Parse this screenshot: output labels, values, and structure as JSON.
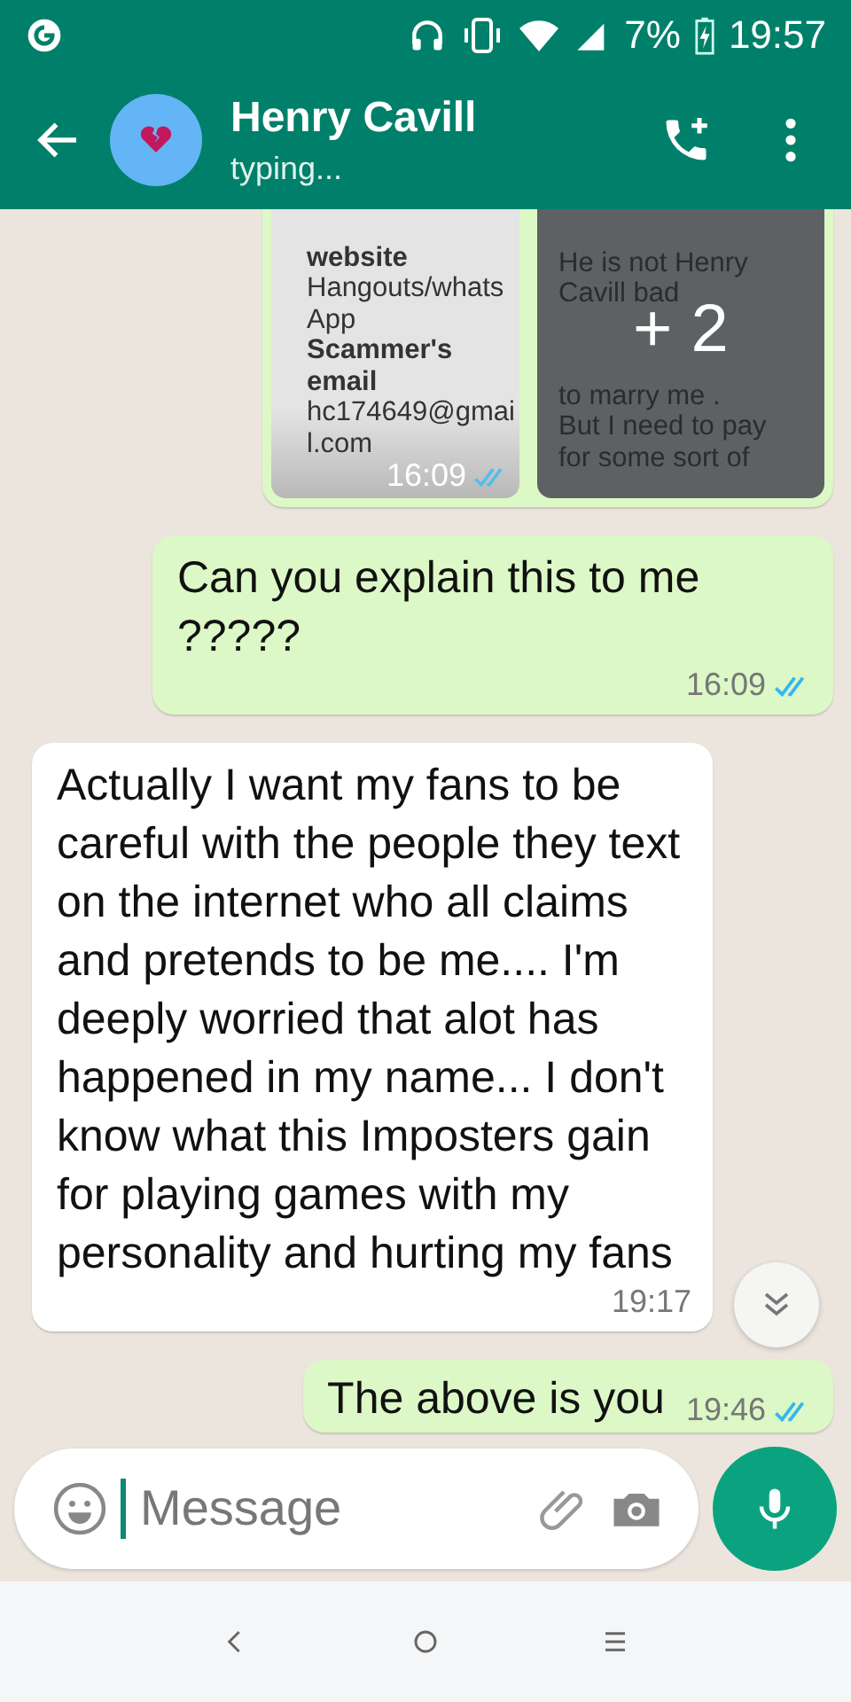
{
  "status_bar": {
    "battery": "7%",
    "time": "19:57"
  },
  "header": {
    "contact_name": "Henry Cavill",
    "presence": "typing..."
  },
  "messages": [
    {
      "kind": "images",
      "time": "16:09",
      "read": true,
      "more_count": "+ 2",
      "images": [
        {
          "lines": [
            {
              "text": "website",
              "bold": true
            },
            {
              "text": "Hangouts/whats",
              "bold": false
            },
            {
              "text": "App",
              "bold": false
            },
            {
              "text": "Scammer's",
              "bold": true
            },
            {
              "text": "email",
              "bold": true
            },
            {
              "text": "hc174649@gmai",
              "bold": false
            },
            {
              "text": "l.com",
              "bold": false
            }
          ]
        },
        {
          "lines": [
            {
              "text": "He is not Henry",
              "bold": false
            },
            {
              "text": "Cavill bad",
              "bold": false
            },
            {
              "text": "to marry me .",
              "bold": false
            },
            {
              "text": "But I need to pay",
              "bold": false
            },
            {
              "text": "for some sort of",
              "bold": false
            }
          ]
        }
      ]
    },
    {
      "kind": "outgoing",
      "text": "Can you explain this to me ?????",
      "time": "16:09",
      "read": true
    },
    {
      "kind": "incoming",
      "text": "Actually I want my fans to be careful with the people they text on the internet who all claims and pretends to be me.... I'm deeply worried that alot has happened in my name... I don't know what this Imposters gain for playing games with my personality and hurting my fans",
      "time": "19:17"
    },
    {
      "kind": "outgoing",
      "text": "The above is you",
      "time": "19:46",
      "read": true
    }
  ],
  "composer": {
    "placeholder": "Message"
  }
}
